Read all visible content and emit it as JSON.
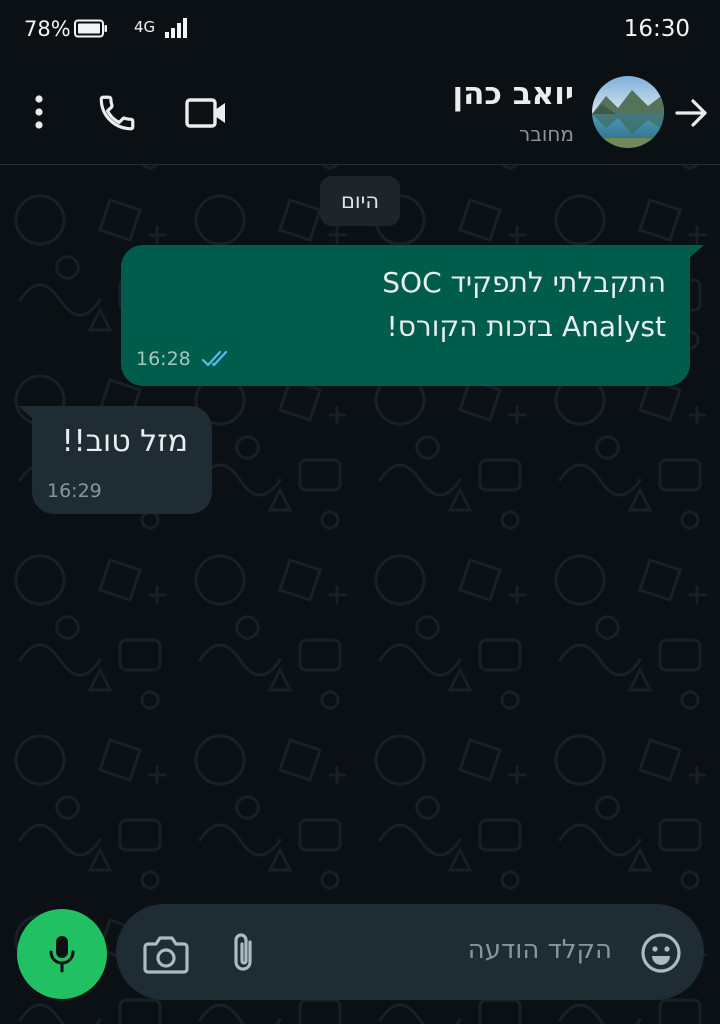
{
  "status_bar": {
    "battery_percent": "78%",
    "network": "4G",
    "time": "16:30"
  },
  "header": {
    "contact_name": "יואב כהן",
    "contact_status": "מחובר",
    "icons": [
      "menu-dots-icon",
      "phone-icon",
      "video-camera-icon",
      "arrow-right-icon"
    ]
  },
  "chat": {
    "date_chip": "היום",
    "messages": [
      {
        "direction": "outgoing",
        "lines": [
          "התקבלתי לתפקיד SOC",
          "Analyst בזכות הקורס!"
        ],
        "time": "16:28",
        "status": "read"
      },
      {
        "direction": "incoming",
        "text": "מזל טוב!!",
        "time": "16:29"
      }
    ]
  },
  "composer": {
    "placeholder": "הקלד הודעה",
    "icons": [
      "emoji-icon",
      "attach-icon",
      "camera-icon",
      "mic-icon"
    ]
  },
  "colors": {
    "background": "#0b1014",
    "outgoing_bubble": "#005c4b",
    "incoming_bubble": "#1f2c33",
    "accent_green": "#21c063",
    "read_ticks": "#53bdeb"
  }
}
